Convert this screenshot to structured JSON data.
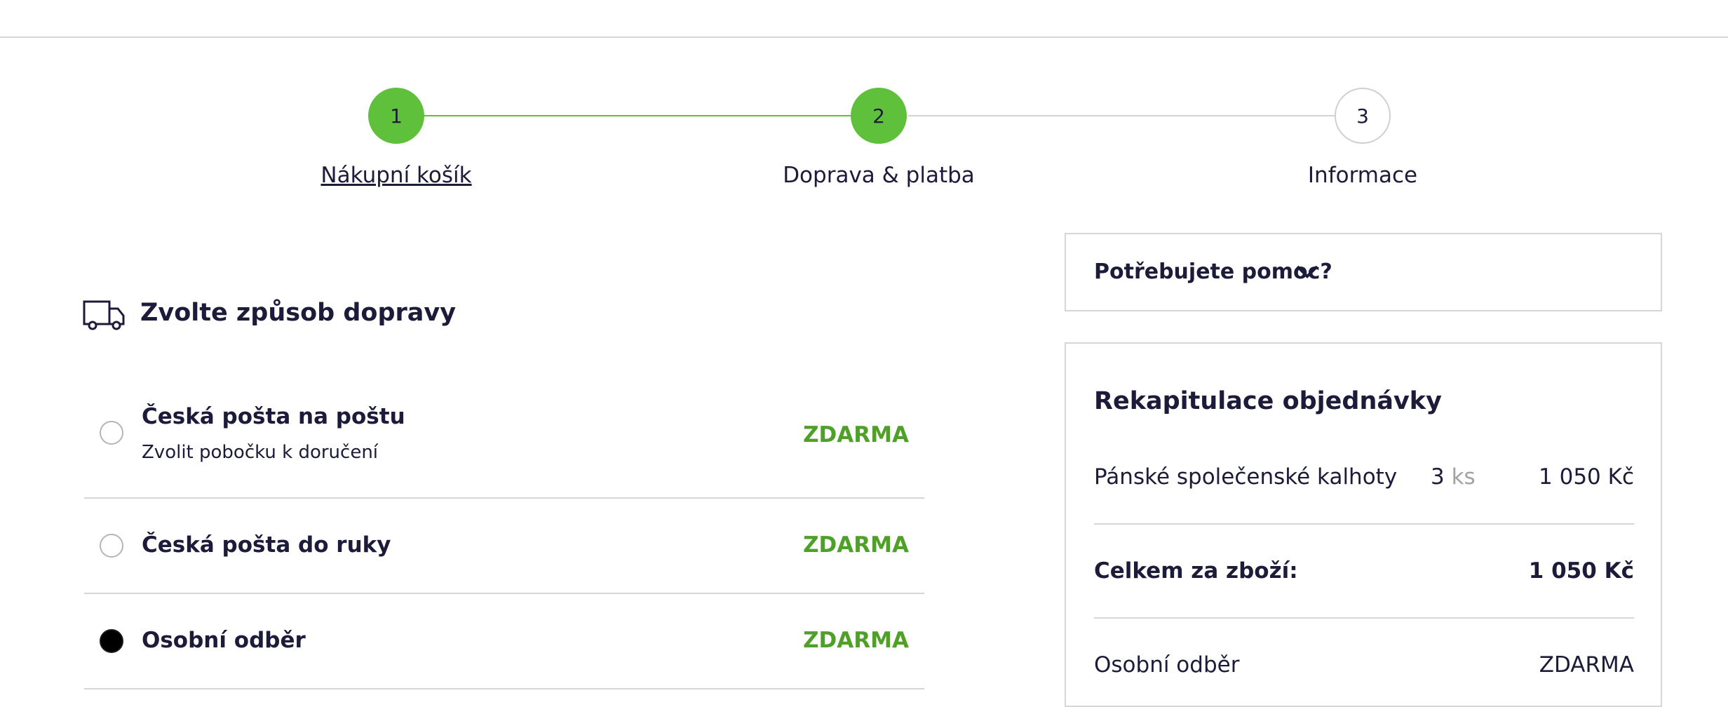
{
  "stepper": {
    "steps": [
      {
        "number": "1",
        "label": "Nákupní košík",
        "state": "done"
      },
      {
        "number": "2",
        "label": "Doprava & platba",
        "state": "current"
      },
      {
        "number": "3",
        "label": "Informace",
        "state": "upcoming"
      }
    ]
  },
  "shipping": {
    "title": "Zvolte způsob dopravy",
    "icon": "truck-icon",
    "options": [
      {
        "name": "Česká pošta na poštu",
        "sub": "Zvolit pobočku k doručení",
        "price": "ZDARMA",
        "selected": false
      },
      {
        "name": "Česká pošta do ruky",
        "sub": "",
        "price": "ZDARMA",
        "selected": false
      },
      {
        "name": "Osobní odběr",
        "sub": "",
        "price": "ZDARMA",
        "selected": true
      }
    ]
  },
  "help": {
    "label": "Potřebujete pomoc?",
    "icon": "chevron-down-icon"
  },
  "summary": {
    "title": "Rekapitulace objednávky",
    "item": {
      "name": "Pánské společenské kalhoty",
      "qty": "3",
      "unit": "ks",
      "price": "1 050 Kč"
    },
    "total_label": "Celkem za zboží:",
    "total_value": "1 050 Kč",
    "shipping_label": "Osobní odběr",
    "shipping_value": "ZDARMA"
  },
  "colors": {
    "accent_green": "#5fc13b",
    "price_green": "#4fa028",
    "text_dark": "#1d1b3a"
  }
}
